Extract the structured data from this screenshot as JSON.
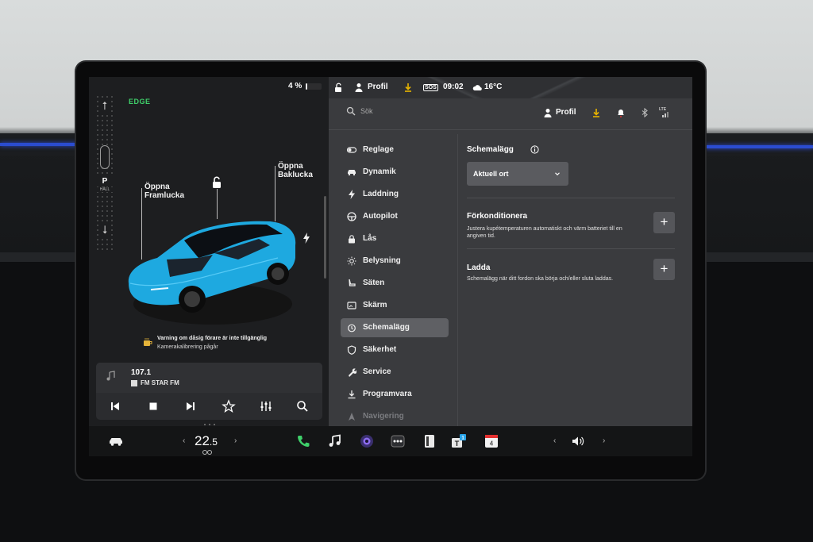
{
  "status": {
    "battery_percent": "4 %",
    "battery_level": 0.04,
    "profile": "Profil",
    "sos": "SOS",
    "time": "09:02",
    "temperature": "16°C"
  },
  "left_panel": {
    "logo": "EDGE",
    "gear": "P",
    "gear_sub": "HÅLL",
    "frunk_label": [
      "Öppna",
      "Framlucka"
    ],
    "trunk_label": [
      "Öppna",
      "Baklucka"
    ],
    "warning_title": "Varning om dåsig förare är inte tillgänglig",
    "warning_sub": "Kamerakalibrering pågår"
  },
  "media": {
    "frequency": "107.1",
    "station": "FM STAR FM"
  },
  "search": {
    "placeholder": "Sök",
    "profile": "Profil",
    "lte": "LTE"
  },
  "menu": [
    {
      "label": "Reglage",
      "icon": "toggle-icon"
    },
    {
      "label": "Dynamik",
      "icon": "car-icon"
    },
    {
      "label": "Laddning",
      "icon": "bolt-icon"
    },
    {
      "label": "Autopilot",
      "icon": "steering-wheel-icon"
    },
    {
      "label": "Lås",
      "icon": "lock-icon"
    },
    {
      "label": "Belysning",
      "icon": "sun-icon"
    },
    {
      "label": "Säten",
      "icon": "seat-icon"
    },
    {
      "label": "Skärm",
      "icon": "display-icon"
    },
    {
      "label": "Schemalägg",
      "icon": "alarm-clock-icon",
      "active": true
    },
    {
      "label": "Säkerhet",
      "icon": "shield-icon"
    },
    {
      "label": "Service",
      "icon": "wrench-icon"
    },
    {
      "label": "Programvara",
      "icon": "download-icon"
    },
    {
      "label": "Navigering",
      "icon": "navigation-icon",
      "faded": true
    }
  ],
  "content": {
    "title": "Schemalägg",
    "location_value": "Aktuell ort",
    "sections": [
      {
        "title": "Förkonditionera",
        "desc": "Justera kupétemperaturen automatiskt och värm batteriet till en angiven tid."
      },
      {
        "title": "Ladda",
        "desc": "Schemalägg när ditt fordon ska börja och/eller sluta laddas."
      }
    ]
  },
  "dock": {
    "temp_whole": "22",
    "temp_decimal": ".5",
    "calendar_day": "4",
    "badge": "1"
  },
  "colors": {
    "accent_green": "#3fd06a",
    "download_yellow": "#e8b400",
    "car_blue": "#20b6ec",
    "alert_red": "#e43030"
  }
}
